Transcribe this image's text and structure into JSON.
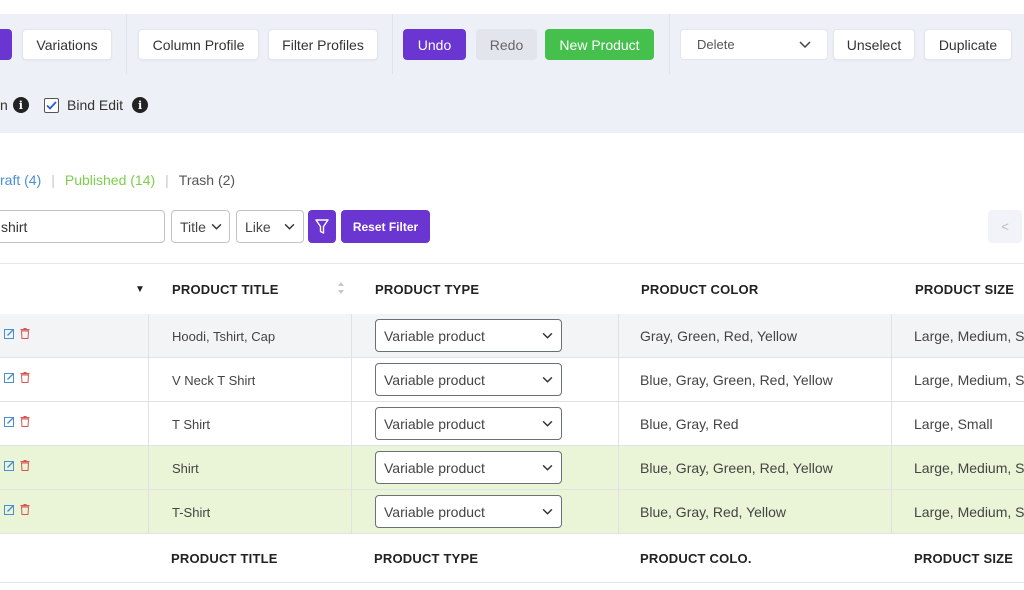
{
  "toolbar": {
    "variations_label": "Variations",
    "column_profile_label": "Column Profile",
    "filter_profiles_label": "Filter Profiles",
    "undo_label": "Undo",
    "redo_label": "Redo",
    "new_product_label": "New Product",
    "bulk_action_value": "Delete",
    "unselect_label": "Unselect",
    "duplicate_label": "Duplicate",
    "option_partial_label": "n",
    "bind_edit_label": "Bind Edit",
    "colors": {
      "purple": "#6a35d1",
      "green": "#46c04c",
      "background": "#eef0f7"
    }
  },
  "status_links": {
    "draft": "raft (4)",
    "published": "Published (14)",
    "trash": "Trash (2)",
    "separator": "|"
  },
  "filter": {
    "search_value": "shirt",
    "field_select": "Title",
    "operator_select": "Like",
    "reset_label": "Reset Filter",
    "pager_prev": "<"
  },
  "table": {
    "sort_indicator": "▼",
    "headers": {
      "title": "PRODUCT TITLE",
      "type": "PRODUCT TYPE",
      "color": "PRODUCT COLOR",
      "size": "PRODUCT SIZE"
    },
    "footer": {
      "title": "PRODUCT TITLE",
      "type": "PRODUCT TYPE",
      "color": "PRODUCT COLO.",
      "size": "PRODUCT SIZE"
    },
    "rows": [
      {
        "title": "Hoodi, Tshirt, Cap",
        "type": "Variable product",
        "color": "Gray, Green, Red, Yellow",
        "size": "Large, Medium, Sm",
        "highlight": "gray"
      },
      {
        "title": "V Neck T Shirt",
        "type": "Variable product",
        "color": "Blue, Gray, Green, Red, Yellow",
        "size": "Large, Medium, Sm",
        "highlight": "none"
      },
      {
        "title": "T Shirt",
        "type": "Variable product",
        "color": "Blue, Gray, Red",
        "size": "Large, Small",
        "highlight": "none"
      },
      {
        "title": "Shirt",
        "type": "Variable product",
        "color": "Blue, Gray, Green, Red, Yellow",
        "size": "Large, Medium, Sm",
        "highlight": "green"
      },
      {
        "title": "T-Shirt",
        "type": "Variable product",
        "color": "Blue, Gray, Red, Yellow",
        "size": "Large, Medium, Sm",
        "highlight": "green"
      }
    ]
  }
}
